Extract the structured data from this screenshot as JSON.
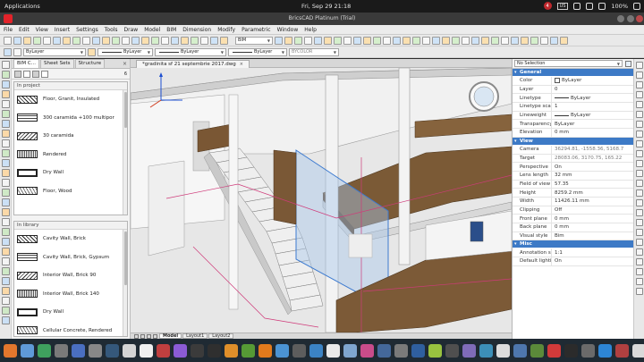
{
  "system": {
    "apps_label": "Applications",
    "datetime": "Fri, Sep 29  21:18",
    "notif_badge": "4",
    "lang": "US",
    "battery": "100%"
  },
  "window": {
    "title": "BricsCAD Platinum (Trial)"
  },
  "menu": [
    "File",
    "Edit",
    "View",
    "Insert",
    "Settings",
    "Tools",
    "Draw",
    "Model",
    "BIM",
    "Dimension",
    "Modify",
    "Parametric",
    "Window",
    "Help"
  ],
  "toolbar": {
    "workspace": "BIM",
    "layer": "ByLayer",
    "linetype": "ByLayer",
    "lineweight": "ByLayer",
    "plotstyle": "BYCOLOR"
  },
  "bim_panel": {
    "tabs": [
      "BIM C...",
      "Sheet Sets",
      "Structure"
    ],
    "count": "6",
    "in_project_label": "In project",
    "in_project": [
      "Floor, Granit, Insulated",
      "300 caramida +100 multipor",
      "30 caramida",
      "Rendered",
      "Dry Wall",
      "Floor, Wood"
    ],
    "in_library_label": "In library",
    "in_library": [
      "Cavity Wall, Brick",
      "Cavity Wall, Brick, Gypsum",
      "Interior Wall, Brick 90",
      "Interior Wall, Brick 140",
      "Dry Wall",
      "Cellular Concrete, Rendered"
    ]
  },
  "document": {
    "tab": "*gradinita sf 21 septembrie 2017.dwg",
    "layout_tabs": [
      "Model",
      "Layout1",
      "Layout2"
    ]
  },
  "properties": {
    "selection": "No Selection",
    "general_label": "General",
    "general": [
      {
        "k": "Color",
        "v": "ByLayer"
      },
      {
        "k": "Layer",
        "v": "0"
      },
      {
        "k": "Linetype",
        "v": "ByLayer"
      },
      {
        "k": "Linetype scale",
        "v": "1"
      },
      {
        "k": "Lineweight",
        "v": "ByLayer"
      },
      {
        "k": "Transparency",
        "v": "ByLayer"
      },
      {
        "k": "Elevation",
        "v": "0 mm"
      }
    ],
    "view_label": "View",
    "view": [
      {
        "k": "Camera",
        "v": "36294.81, -1558.36, 5168.7"
      },
      {
        "k": "Target",
        "v": "28083.06, 3170.75, 165.22"
      },
      {
        "k": "Perspective",
        "v": "On"
      },
      {
        "k": "Lens length",
        "v": "32 mm"
      },
      {
        "k": "Field of view",
        "v": "57.35"
      },
      {
        "k": "Height",
        "v": "8259.2 mm"
      },
      {
        "k": "Width",
        "v": "11426.11 mm"
      },
      {
        "k": "Clipping",
        "v": "Off"
      },
      {
        "k": "Front plane",
        "v": "0 mm"
      },
      {
        "k": "Back plane",
        "v": "0 mm"
      },
      {
        "k": "Visual style",
        "v": "Bim"
      }
    ],
    "misc_label": "Misc",
    "misc": [
      {
        "k": "Annotation sc.",
        "v": "1:1"
      },
      {
        "k": "Default lighting",
        "v": "On"
      }
    ]
  },
  "dock_icons": [
    "firefox-icon",
    "files-icon",
    "chat-icon",
    "pinguy-icon",
    "mail-icon",
    "settings-icon",
    "monitor-icon",
    "calendar-icon",
    "document-icon",
    "app-icon",
    "app-icon",
    "app-icon",
    "terminal-icon",
    "app-icon",
    "app-icon",
    "vlc-icon",
    "app-icon",
    "app-icon",
    "app-icon",
    "app-icon",
    "app-icon",
    "app-icon",
    "app-icon",
    "app-icon",
    "app-icon",
    "app-icon",
    "app-icon",
    "app-icon",
    "app-icon",
    "app-icon",
    "app-icon",
    "app-icon",
    "bricscad-icon",
    "app-icon",
    "app-icon",
    "app-icon",
    "app-icon",
    "app-icon",
    "app-icon"
  ]
}
